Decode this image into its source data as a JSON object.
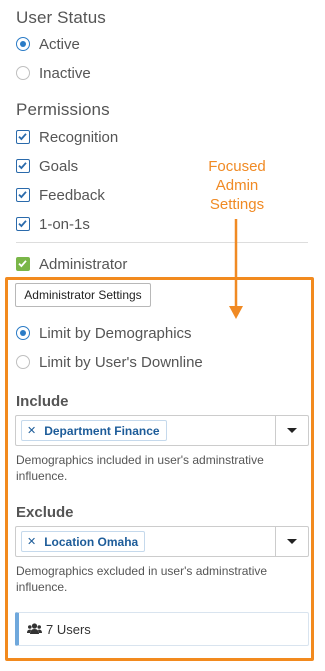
{
  "user_status": {
    "title": "User Status",
    "options": [
      {
        "label": "Active",
        "selected": true
      },
      {
        "label": "Inactive",
        "selected": false
      }
    ]
  },
  "permissions": {
    "title": "Permissions",
    "items": [
      {
        "label": "Recognition",
        "checked": true
      },
      {
        "label": "Goals",
        "checked": true
      },
      {
        "label": "Feedback",
        "checked": true
      },
      {
        "label": "1-on-1s",
        "checked": true
      }
    ],
    "administrator": {
      "label": "Administrator",
      "checked": true
    }
  },
  "annotation": {
    "text": "Focused Admin Settings",
    "color": "#f08a24"
  },
  "admin_settings": {
    "button_label": "Administrator Settings",
    "scope_options": [
      {
        "label": "Limit by Demographics",
        "selected": true
      },
      {
        "label": "Limit by User's Downline",
        "selected": false
      }
    ],
    "include": {
      "label": "Include",
      "tags": [
        "Department Finance"
      ],
      "help": "Demographics included in user's adminstrative influence."
    },
    "exclude": {
      "label": "Exclude",
      "tags": [
        "Location Omaha"
      ],
      "help": "Demographics excluded in user's adminstrative influence."
    },
    "users_count": "7 Users"
  },
  "colors": {
    "accent_blue": "#2a7bc6",
    "admin_check_green": "#7ab648",
    "focus_orange": "#f28a1e",
    "tag_text": "#1d5c99"
  },
  "icons": {
    "check": "check-icon",
    "remove": "remove-tag-icon",
    "dropdown": "caret-down-icon",
    "users": "users-icon"
  }
}
